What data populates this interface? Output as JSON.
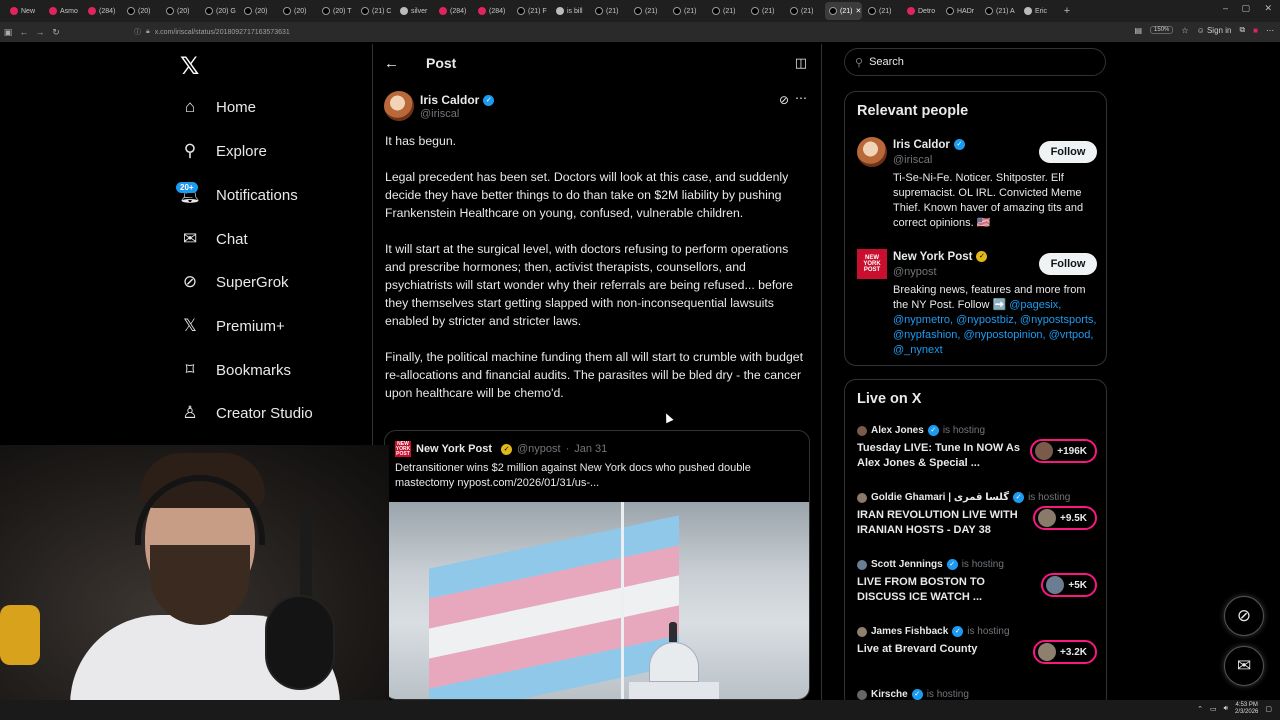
{
  "browser": {
    "tabs": [
      {
        "label": "New",
        "fav": "red"
      },
      {
        "label": "Asmo",
        "fav": "red"
      },
      {
        "label": "(284)",
        "fav": "red"
      },
      {
        "label": "(20) ",
        "fav": "blk"
      },
      {
        "label": "(20) ",
        "fav": "blk"
      },
      {
        "label": "(20) G",
        "fav": "blk"
      },
      {
        "label": "(20) ",
        "fav": "blk"
      },
      {
        "label": "(20) ",
        "fav": "blk"
      },
      {
        "label": "(20) T",
        "fav": "blk"
      },
      {
        "label": "(21) C",
        "fav": "blk"
      },
      {
        "label": "silver",
        "fav": "gray"
      },
      {
        "label": "(284)",
        "fav": "red"
      },
      {
        "label": "(284)",
        "fav": "red"
      },
      {
        "label": "(21) F",
        "fav": "blk"
      },
      {
        "label": "is bill",
        "fav": "gray"
      },
      {
        "label": "(21) ",
        "fav": "blk"
      },
      {
        "label": "(21) ",
        "fav": "blk"
      },
      {
        "label": "(21) ",
        "fav": "blk"
      },
      {
        "label": "(21) ",
        "fav": "blk"
      },
      {
        "label": "(21) ",
        "fav": "blk"
      },
      {
        "label": "(21) ",
        "fav": "blk"
      },
      {
        "label": "(21) ",
        "fav": "blk",
        "active": true
      },
      {
        "label": "(21) ",
        "fav": "blk"
      },
      {
        "label": "Detro",
        "fav": "red"
      },
      {
        "label": "HADr",
        "fav": "blk"
      },
      {
        "label": "(21) A",
        "fav": "blk"
      },
      {
        "label": "Eric",
        "fav": "gray"
      }
    ],
    "new_tab": "+",
    "url": "x.com/iriscal/status/2018092717163573631",
    "zoom": "150%",
    "sign_in": "Sign in"
  },
  "nav": {
    "logo": "𝕏",
    "items": [
      {
        "label": "Home",
        "icon": "home-icon",
        "glyph": "⌂"
      },
      {
        "label": "Explore",
        "icon": "search-icon",
        "glyph": "⚲"
      },
      {
        "label": "Notifications",
        "icon": "bell-icon",
        "glyph": "🔔︎"
      },
      {
        "label": "Chat",
        "icon": "mail-icon",
        "glyph": "✉"
      },
      {
        "label": "SuperGrok",
        "icon": "grok-icon",
        "glyph": "⊘"
      },
      {
        "label": "Premium+",
        "icon": "x-premium-icon",
        "glyph": "𝕏"
      },
      {
        "label": "Bookmarks",
        "icon": "bookmark-icon",
        "glyph": "⌑"
      },
      {
        "label": "Creator Studio",
        "icon": "creator-studio-icon",
        "glyph": "♙"
      }
    ],
    "notif_badge": "20+"
  },
  "post": {
    "header_title": "Post",
    "author_name": "Iris Caldor",
    "author_handle": "@iriscal",
    "paragraphs": [
      "It has begun.",
      "Legal precedent has been set. Doctors will look at this case, and suddenly decide they have better things to do than take on $2M liability by pushing Frankenstein Healthcare on young, confused, vulnerable children.",
      "It will start at the surgical level, with doctors refusing to perform operations and prescribe hormones; then, activist therapists, counsellors, and psychiatrists will start wonder why their referrals are being refused... before they themselves start getting slapped with non-inconsequential lawsuits enabled by stricter and stricter laws.",
      "Finally, the political machine funding them all will start to crumble with budget re-allocations and financial audits. The parasites will be bled dry - the cancer upon healthcare will be chemo'd."
    ],
    "quote": {
      "name": "New York Post",
      "handle": "@nypost",
      "sep": "·",
      "date": "Jan 31",
      "text": "Detransitioner wins $2 million against New York docs who pushed double mastectomy nypost.com/2026/01/31/us-..."
    }
  },
  "search": {
    "placeholder": "Search"
  },
  "relevant": {
    "title": "Relevant people",
    "people": [
      {
        "name": "Iris Caldor",
        "handle": "@iriscal",
        "badge": "blue",
        "follow": "Follow",
        "bio": "Ti-Se-Ni-Fe. Noticer. Shitposter. Elf supremacist. OL IRL. Convicted Meme Thief. Known haver of amazing tits and correct opinions. 🇺🇸"
      },
      {
        "name": "New York Post",
        "handle": "@nypost",
        "badge": "gold",
        "follow": "Follow",
        "bio_text": "Breaking news, features and more from the NY Post. Follow ➡️ ",
        "bio_links": [
          "@pagesix,",
          "@nypmetro,",
          "@nypostbiz,",
          "@nypostsports,",
          "@nypfashion,",
          "@nypostopinion,",
          "@vrtpod,",
          "@_nynext"
        ]
      }
    ]
  },
  "live": {
    "title": "Live on X",
    "items": [
      {
        "host": "Alex Jones",
        "status": "is hosting",
        "title": "Tuesday LIVE: Tune In NOW As Alex Jones & Special ...",
        "count": "+196K"
      },
      {
        "host": "Goldie Ghamari | گلسا قمری",
        "status": "is hosting",
        "title": "IRAN REVOLUTION LIVE WITH IRANIAN HOSTS - DAY 38",
        "count": "+9.5K"
      },
      {
        "host": "Scott Jennings",
        "status": "is hosting",
        "title": "LIVE FROM BOSTON TO DISCUSS ICE WATCH ...",
        "count": "+5K"
      },
      {
        "host": "James Fishback",
        "status": "is hosting",
        "title": "Live at Brevard County",
        "count": "+3.2K"
      },
      {
        "host": "Kirsche",
        "status": "is hosting",
        "title": "",
        "count": ""
      }
    ]
  },
  "taskbar": {
    "time": "4:53 PM",
    "date": "2/3/2026"
  },
  "colors": {
    "accent": "#1d9bf0",
    "live": "#f91880",
    "border": "#2f3336",
    "muted": "#71767b"
  }
}
